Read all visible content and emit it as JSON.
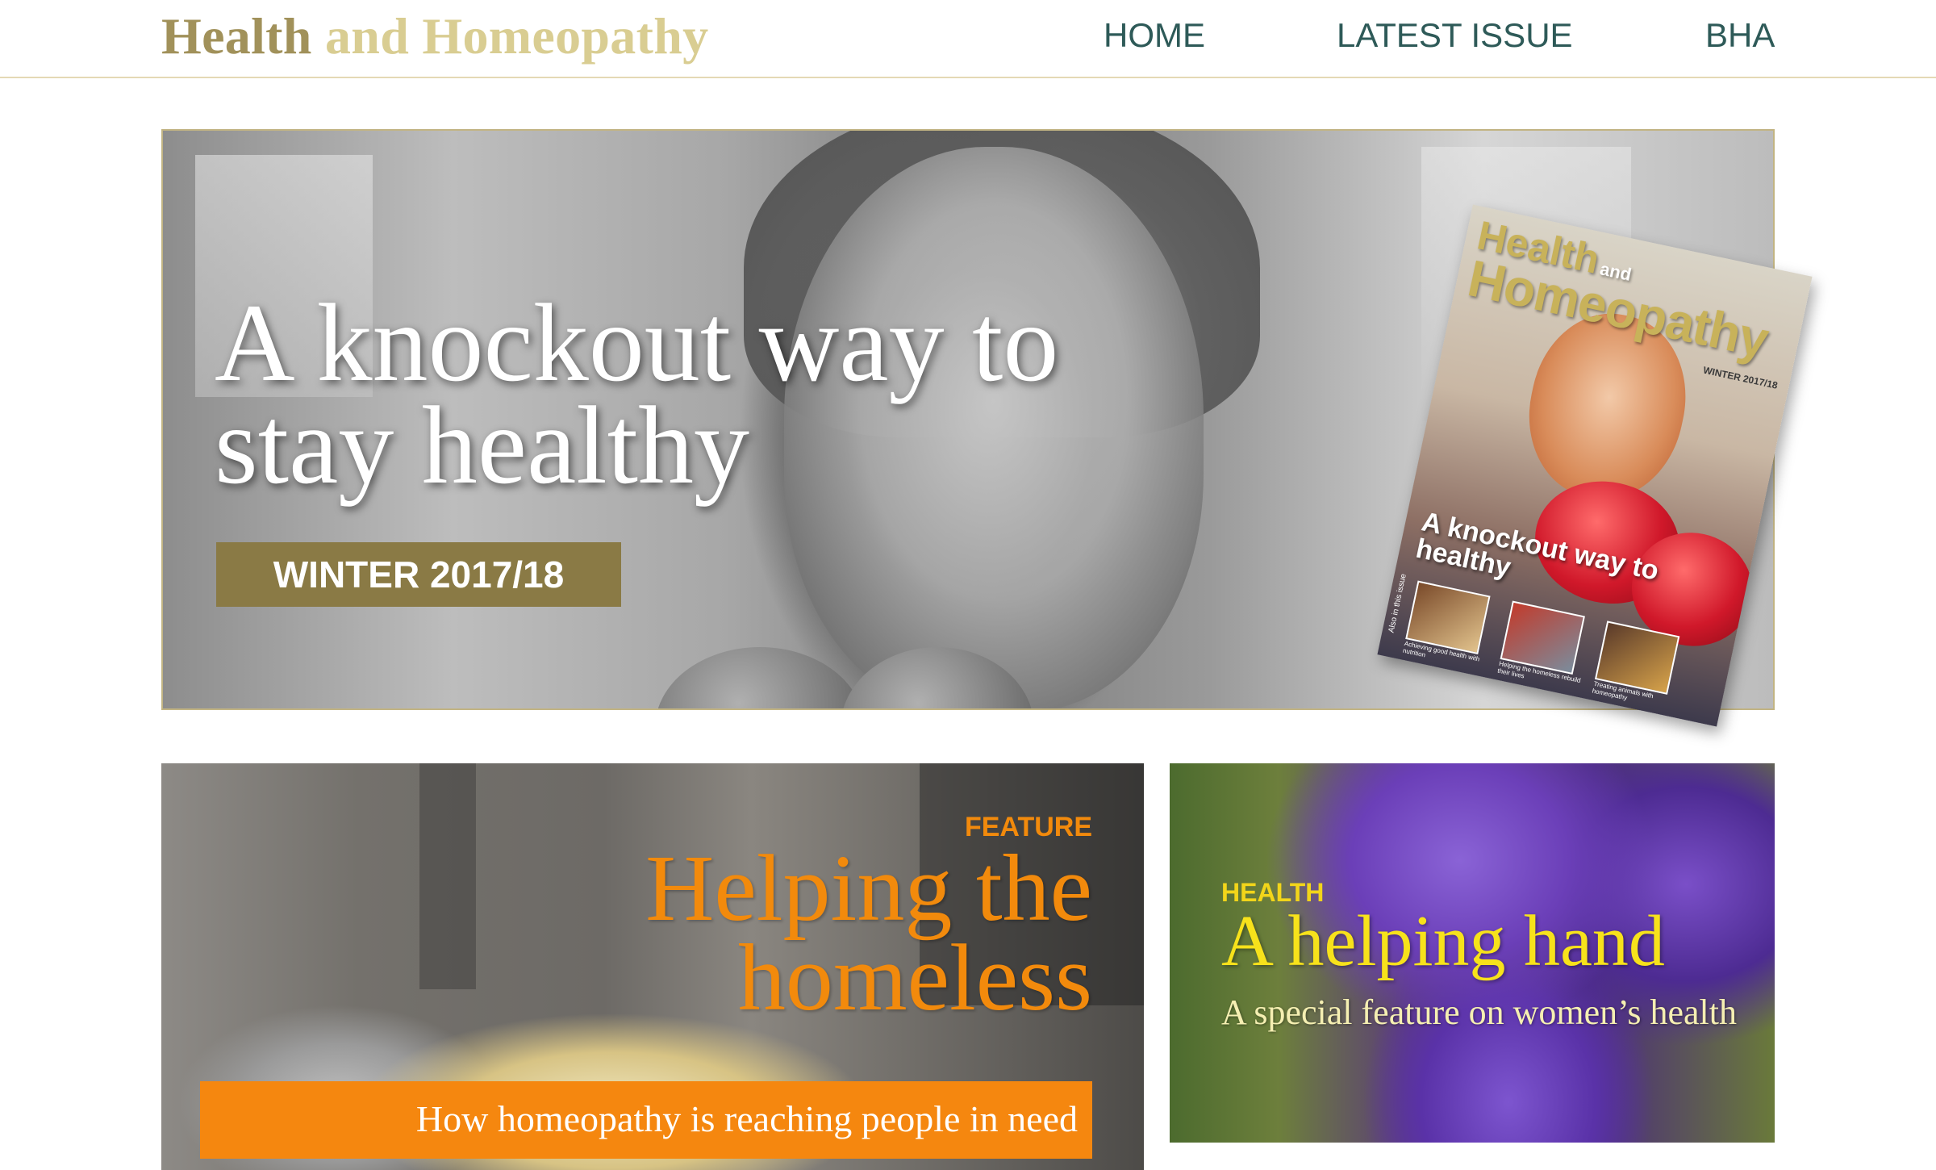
{
  "header": {
    "logo_part1": "Health",
    "logo_part2": "and Homeopathy",
    "nav": [
      "HOME",
      "LATEST ISSUE",
      "BHA"
    ]
  },
  "hero": {
    "title_line1": "A knockout way to",
    "title_line2": "stay healthy",
    "badge": "WINTER 2017/18",
    "cover": {
      "title_top": "Health",
      "title_and": "and",
      "title_bottom": "Homeopathy",
      "issue": "WINTER 2017/18",
      "headline": "A knockout way to healthy",
      "side_text": "Also in this issue",
      "captions": [
        "Achieving good health with nutrition",
        "Helping the homeless rebuild their lives",
        "Treating animals with homeopathy"
      ]
    }
  },
  "feature_card": {
    "tag": "FEATURE",
    "title_line1": "Helping the",
    "title_line2": "homeless",
    "subtitle": "How homeopathy is reaching people in need"
  },
  "health_card": {
    "tag": "HEALTH",
    "title": "A helping hand",
    "subtitle": "A special feature on women’s health"
  },
  "colors": {
    "logo_dark": "#a1915a",
    "logo_light": "#d9cd92",
    "nav": "#2e5a58",
    "badge_bg": "#8a7a45",
    "feature_orange": "#f28a0c",
    "health_yellow": "#f7e21b"
  }
}
